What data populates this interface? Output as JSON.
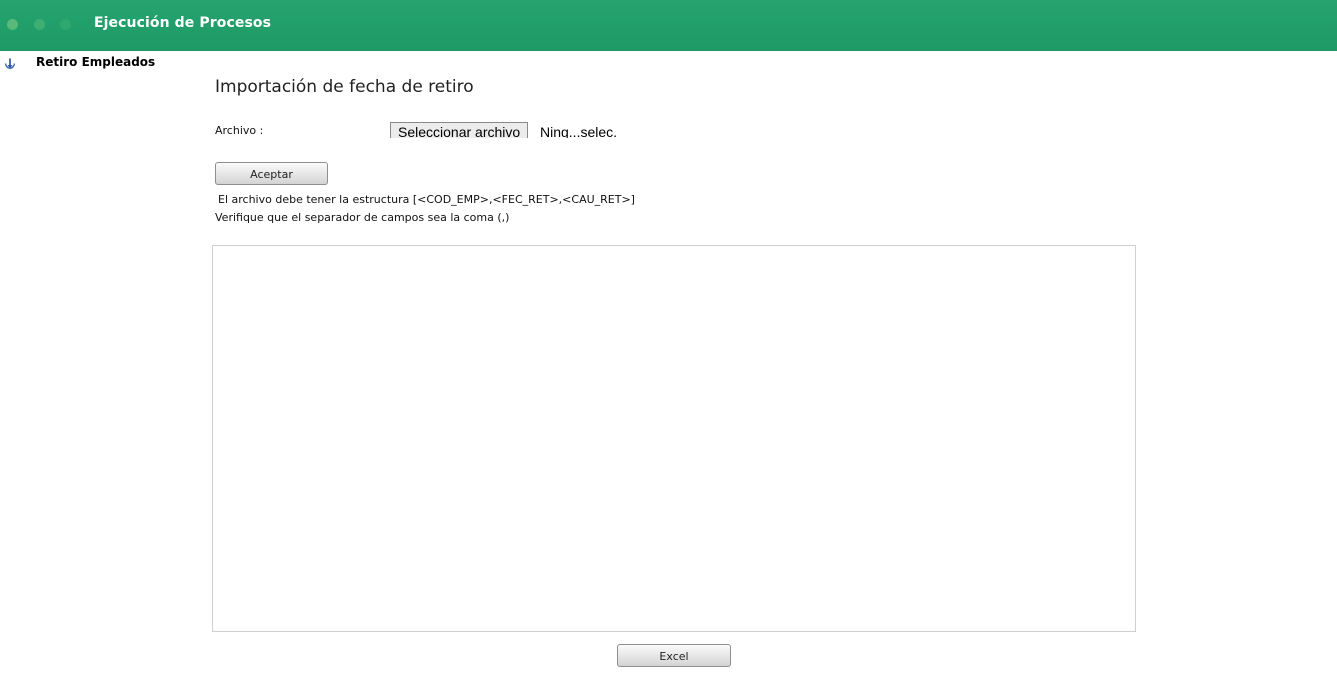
{
  "window": {
    "title": "Ejecución de Procesos"
  },
  "nav": {
    "icon": "down-arrow-icon",
    "label": "Retiro Empleados"
  },
  "main": {
    "heading": "Importación de fecha de retiro",
    "file_label": "Archivo :",
    "file_button_label": "Seleccionar archivo",
    "file_status": "Ning...selec.",
    "accept_button_label": "Aceptar",
    "info_structure": "El archivo debe tener la estructura [<COD_EMP>,<FEC_RET>,<CAU_RET>]",
    "info_separator": "Verifique que el separador de campos sea la coma (,)",
    "excel_button_label": "Excel"
  },
  "colors": {
    "titlebar": "#1f9d69",
    "title_text": "#ffffff",
    "panel_border": "#cfcfcf"
  }
}
